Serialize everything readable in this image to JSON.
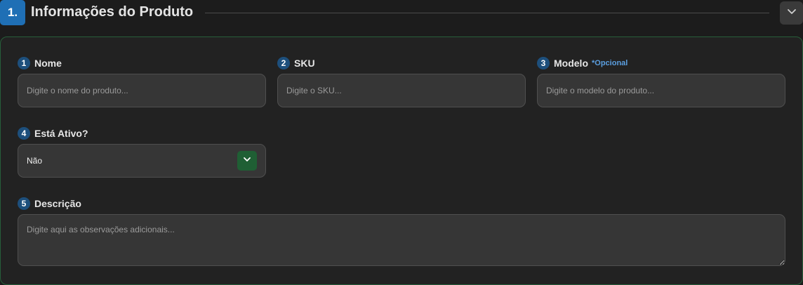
{
  "section": {
    "step": "1.",
    "title": "Informações do Produto",
    "collapse_icon": "chevron-down-icon"
  },
  "fields": {
    "nome": {
      "number": "1",
      "label": "Nome",
      "placeholder": "Digite o nome do produto...",
      "value": ""
    },
    "sku": {
      "number": "2",
      "label": "SKU",
      "placeholder": "Digite o SKU...",
      "value": ""
    },
    "modelo": {
      "number": "3",
      "label": "Modelo",
      "optional_tag": "*Opcional",
      "placeholder": "Digite o modelo do produto...",
      "value": ""
    },
    "ativo": {
      "number": "4",
      "label": "Está Ativo?",
      "selected": "Não",
      "toggle_icon": "chevron-down-icon"
    },
    "descricao": {
      "number": "5",
      "label": "Descrição",
      "placeholder": "Digite aqui as observações adicionais...",
      "value": ""
    }
  },
  "colors": {
    "accent_blue": "#1f6fb5",
    "accent_green": "#1f5f34",
    "card_border": "#275f3a",
    "optional_text": "#5b9fe0"
  }
}
